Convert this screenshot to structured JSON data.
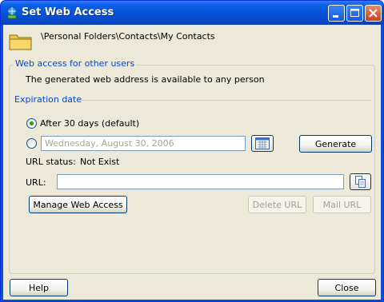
{
  "window": {
    "title": "Set Web Access",
    "controls": {
      "minimize": "minimize-icon",
      "maximize": "maximize-icon",
      "close": "close-icon"
    }
  },
  "folder": {
    "icon": "folder-icon",
    "path": "\\Personal Folders\\Contacts\\My Contacts"
  },
  "web_access": {
    "group_title": "Web access for other users",
    "info": "The generated web address is available to any person",
    "expiration": {
      "label": "Expiration date",
      "option_default": {
        "label": "After 30 days (default)",
        "selected": true
      },
      "option_custom": {
        "selected": false,
        "date_value": "Wednesday, August 30, 2006",
        "calendar_icon": "calendar-icon"
      }
    },
    "generate_label": "Generate",
    "status_label": "URL status:",
    "status_value": "Not Exist",
    "url_label": "URL:",
    "url_value": "",
    "copy_icon": "copy-icon",
    "manage_label": "Manage Web Access",
    "delete_label": "Delete URL",
    "mail_label": "Mail URL"
  },
  "footer": {
    "help_label": "Help",
    "close_label": "Close"
  },
  "colors": {
    "titlebar": "#0553d8",
    "dialog_bg": "#ece9d8",
    "group_title": "#0046d5",
    "radio_dot": "#21a121",
    "disabled_text": "#a1a192"
  }
}
